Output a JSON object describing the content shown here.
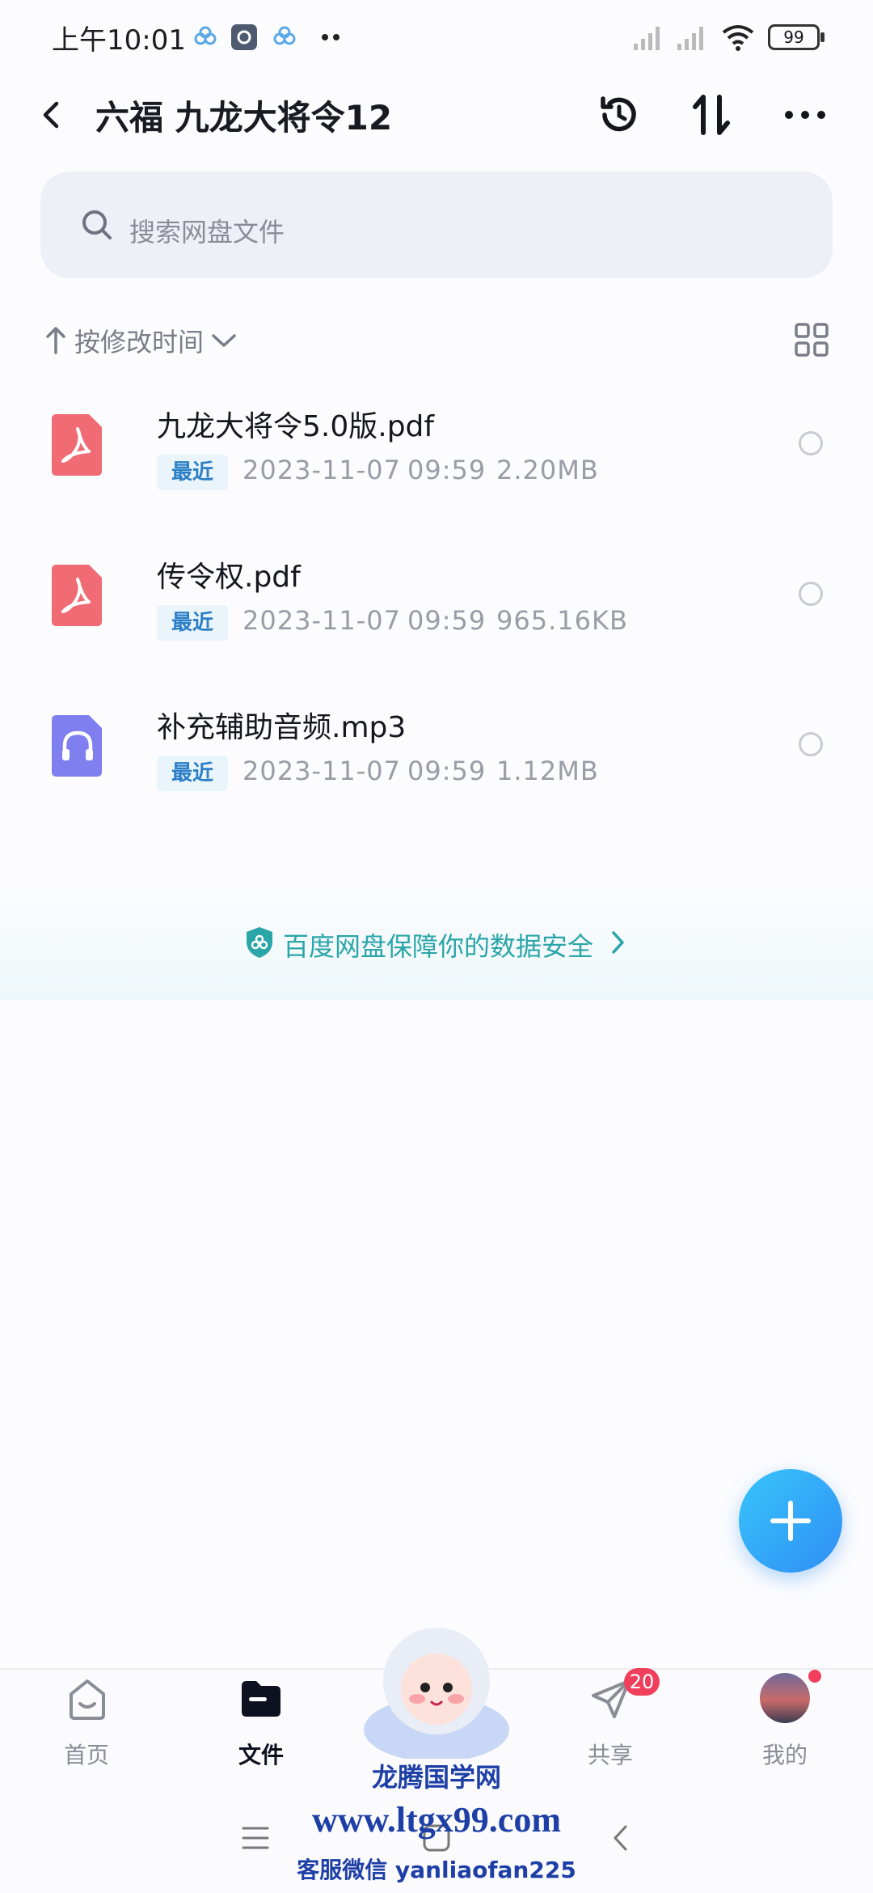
{
  "status": {
    "time": "上午10:01",
    "battery": "99"
  },
  "header": {
    "title": "六福 九龙大将令12"
  },
  "search": {
    "placeholder": "搜索网盘文件"
  },
  "sort": {
    "label": "按修改时间"
  },
  "files": [
    {
      "name": "九龙大将令5.0版.pdf",
      "tag": "最近",
      "date": "2023-11-07",
      "time": "09:59",
      "size": "2.20MB",
      "type": "pdf-icon"
    },
    {
      "name": "传令权.pdf",
      "tag": "最近",
      "date": "2023-11-07",
      "time": "09:59",
      "size": "965.16KB",
      "type": "pdf-icon"
    },
    {
      "name": "补充辅助音频.mp3",
      "tag": "最近",
      "date": "2023-11-07",
      "time": "09:59",
      "size": "1.12MB",
      "type": "audio-icon"
    }
  ],
  "banner": {
    "text": "百度网盘保障你的数据安全"
  },
  "tabs": [
    {
      "label": "首页"
    },
    {
      "label": "文件"
    },
    {
      "label": "共享",
      "badge": "20"
    },
    {
      "label": "我的"
    }
  ],
  "watermark": {
    "site": "龙腾国学网",
    "url": "www.ltgx99.com",
    "contact": "客服微信 yanliaofan225"
  },
  "colors": {
    "accent": "#2f8ef4",
    "pdf": "#f06b73",
    "audio": "#7f7ff0",
    "badge": "#ef3f5d"
  }
}
